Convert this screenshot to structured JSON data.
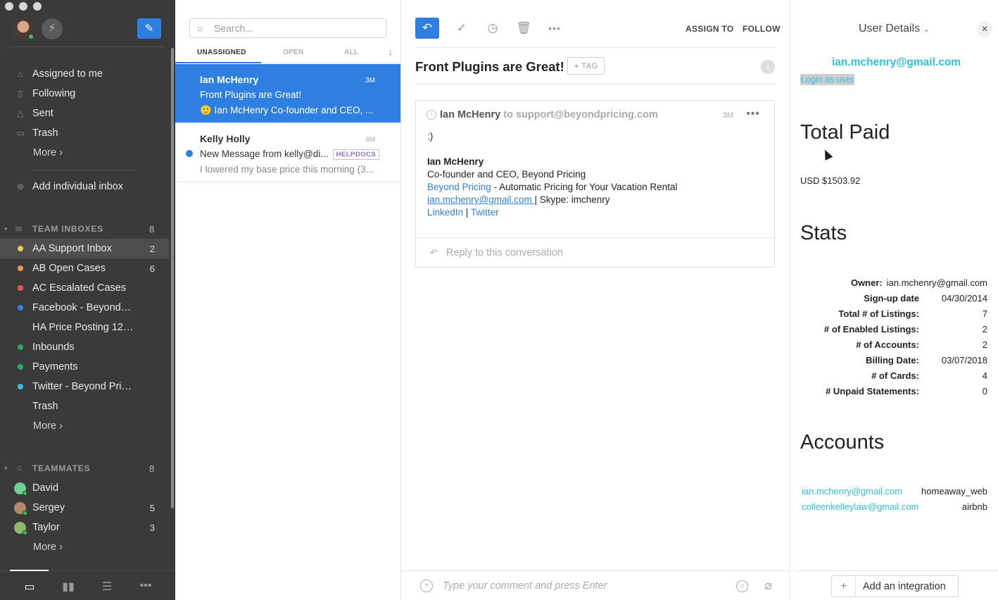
{
  "sidebar": {
    "nav": [
      {
        "label": "Assigned to me",
        "icon": "home-icon"
      },
      {
        "label": "Following",
        "icon": "bookmark-icon"
      },
      {
        "label": "Sent",
        "icon": "send-icon"
      },
      {
        "label": "Trash",
        "icon": "trash-icon"
      }
    ],
    "more_label": "More ›",
    "add_inbox_label": "Add individual inbox",
    "team_header": "TEAM INBOXES",
    "team_count": "8",
    "team_inboxes": [
      {
        "label": "AA Support Inbox",
        "count": "2",
        "color": "#f2c94c"
      },
      {
        "label": "AB Open Cases",
        "count": "6",
        "color": "#f2994a"
      },
      {
        "label": "AC Escalated Cases",
        "count": "",
        "color": "#eb5757"
      },
      {
        "label": "Facebook - Beyond Pric...",
        "count": "",
        "color": "#2f80ed"
      },
      {
        "label": "HA Price Posting 12/12",
        "count": "",
        "color": ""
      },
      {
        "label": "Inbounds",
        "count": "",
        "color": "#27ae60"
      },
      {
        "label": "Payments",
        "count": "",
        "color": "#27ae60"
      },
      {
        "label": "Twitter - Beyond Pricing",
        "count": "",
        "color": "#2ec1e0"
      },
      {
        "label": "Trash",
        "count": "",
        "color": ""
      }
    ],
    "teammates_header": "TEAMMATES",
    "teammates_count": "8",
    "teammates": [
      {
        "label": "David",
        "count": ""
      },
      {
        "label": "Sergey",
        "count": "5"
      },
      {
        "label": "Taylor",
        "count": "3"
      }
    ]
  },
  "list": {
    "search_placeholder": "Search...",
    "tabs": [
      "UNASSIGNED",
      "OPEN",
      "ALL"
    ],
    "conversations": [
      {
        "name": "Ian McHenry",
        "time": "3M",
        "subject": "Front Plugins are Great!",
        "preview": "🙂 Ian McHenry Co-founder and CEO, ..."
      },
      {
        "name": "Kelly Holly",
        "time": "4M",
        "subject": "New Message from kelly@di...",
        "tag": "HELPDOCS",
        "preview": "I lowered my base price this morning (3..."
      }
    ]
  },
  "message": {
    "toolbar": {
      "assign_label": "ASSIGN TO",
      "follow_label": "FOLLOW"
    },
    "subject": "Front Plugins are Great!",
    "tag_label": "TAG",
    "from_name": "Ian McHenry",
    "to_prefix": "to",
    "to_address": "support@beyondpricing.com",
    "time": "3M",
    "body": {
      "greeting": ":)",
      "sig_name": "Ian McHenry",
      "sig_title": "Co-founder and CEO, Beyond Pricing",
      "link_company": "Beyond Pricing",
      "tagline": " - Automatic Pricing for Your Vacation Rental",
      "email_link": "ian.mchenry@gmail.com ",
      "skype": " | Skype: imchenry",
      "linkedin": "LinkedIn",
      "pipe": " | ",
      "twitter": "Twitter"
    },
    "reply_placeholder": "Reply to this conversation",
    "comment_placeholder": "Type your comment and press Enter"
  },
  "details": {
    "title": "User Details",
    "email": "ian.mchenry@gmail.com",
    "login_label": "Login as user",
    "total_paid_heading": "Total Paid",
    "total_paid_value": "USD $1503.92",
    "stats_heading": "Stats",
    "stats": [
      {
        "k": "Owner:",
        "v": "ian.mchenry@gmail.com"
      },
      {
        "k": "Sign-up date",
        "v": "04/30/2014"
      },
      {
        "k": "Total # of Listings:",
        "v": "7"
      },
      {
        "k": "# of Enabled Listings:",
        "v": "2"
      },
      {
        "k": "# of Accounts:",
        "v": "2"
      },
      {
        "k": "Billing Date:",
        "v": "03/07/2018"
      },
      {
        "k": "# of Cards:",
        "v": "4"
      },
      {
        "k": "# Unpaid Statements:",
        "v": "0"
      }
    ],
    "accounts_heading": "Accounts",
    "accounts": [
      {
        "email": "ian.mchenry@gmail.com",
        "platform": "homeaway_web"
      },
      {
        "email": "colleenkelleylaw@gmail.com",
        "platform": "airbnb"
      }
    ],
    "add_integration_label": "Add an integration"
  }
}
